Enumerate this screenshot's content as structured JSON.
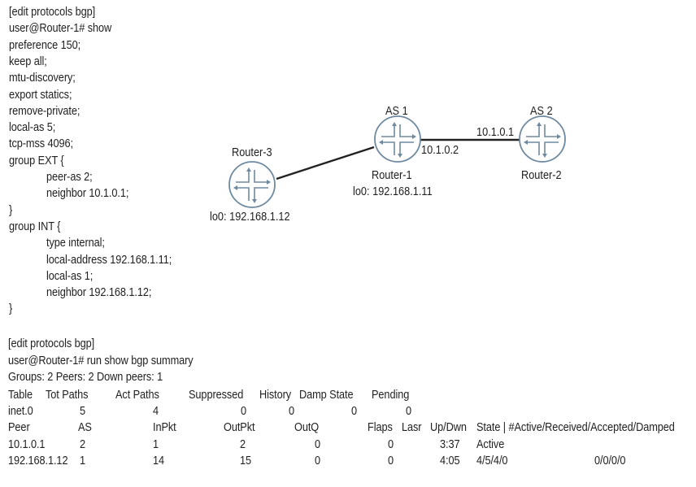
{
  "config": {
    "lines": [
      {
        "text": "[edit protocols bgp]",
        "indent": 0
      },
      {
        "text": "user@Router-1# show",
        "indent": 0
      },
      {
        "text": "preference 150;",
        "indent": 0
      },
      {
        "text": "keep all;",
        "indent": 0
      },
      {
        "text": "mtu-discovery;",
        "indent": 0
      },
      {
        "text": "export statics;",
        "indent": 0
      },
      {
        "text": "remove-private;",
        "indent": 0
      },
      {
        "text": "local-as 5;",
        "indent": 0
      },
      {
        "text": "tcp-mss 4096;",
        "indent": 0
      },
      {
        "text": "group EXT {",
        "indent": 0
      },
      {
        "text": "peer-as 2;",
        "indent": 1
      },
      {
        "text": "neighbor 10.1.0.1;",
        "indent": 1
      },
      {
        "text": "}",
        "indent": 0
      },
      {
        "text": "group INT {",
        "indent": 0
      },
      {
        "text": "type internal;",
        "indent": 1
      },
      {
        "text": "local-address 192.168.1.11;",
        "indent": 1
      },
      {
        "text": "local-as 1;",
        "indent": 1
      },
      {
        "text": "neighbor 192.168.1.12;",
        "indent": 1
      },
      {
        "text": "}",
        "indent": 0
      }
    ]
  },
  "diagram": {
    "router1": {
      "name": "Router-1",
      "as": "AS 1",
      "lo0": "lo0: 192.168.1.11",
      "link_ip": "10.1.0.2"
    },
    "router2": {
      "name": "Router-2",
      "as": "AS 2",
      "link_ip": "10.1.0.1"
    },
    "router3": {
      "name": "Router-3",
      "lo0": "lo0: 192.168.1.12"
    },
    "colors": {
      "router_stroke": "#6f8aa0",
      "link": "#222222"
    }
  },
  "summary": {
    "prompt_context": "[edit protocols bgp]",
    "command": "user@Router-1# run show bgp summary",
    "groups_line": "Groups: 2 Peers: 2 Down peers: 1",
    "table_headers": [
      "Table",
      "Tot Paths",
      "Act Paths",
      "Suppressed",
      "History",
      "Damp State",
      "Pending"
    ],
    "table_row": [
      "inet.0",
      "5",
      "4",
      "0",
      "0",
      "0",
      "0"
    ],
    "peer_headers": [
      "Peer",
      "AS",
      "InPkt",
      "OutPkt",
      "OutQ",
      "Flaps",
      "Lasr",
      "Up/Dwn",
      "State | #Active/Received/Accepted/Damped"
    ],
    "peers": [
      [
        "10.1.0.1",
        "2",
        "1",
        "2",
        "0",
        "0",
        "",
        "3:37",
        "Active",
        ""
      ],
      [
        "192.168.1.12",
        "1",
        "14",
        "15",
        "0",
        "0",
        "",
        "4:05",
        "4/5/4/0",
        "0/0/0/0"
      ]
    ]
  }
}
